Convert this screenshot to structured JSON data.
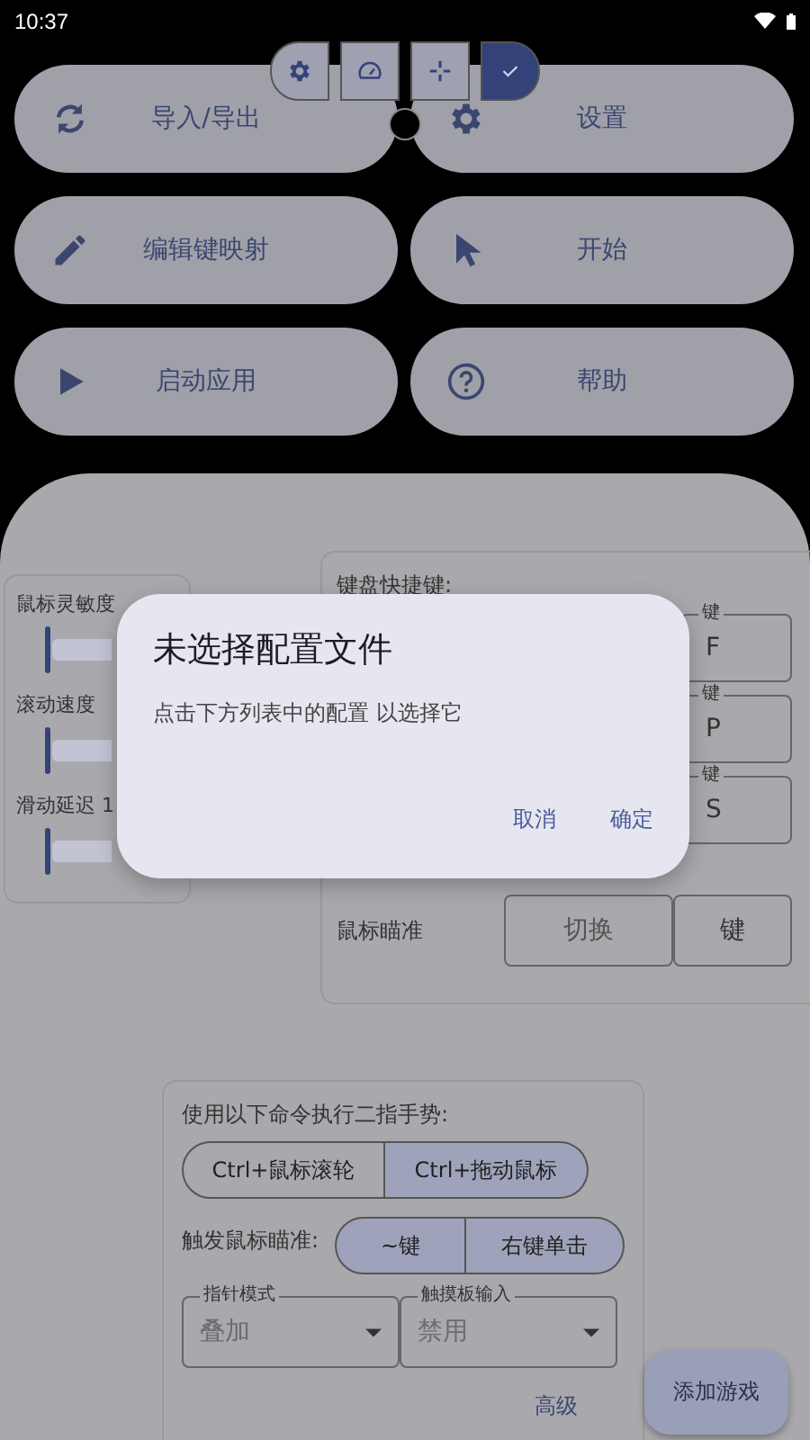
{
  "status_bar": {
    "time": "10:37"
  },
  "toolbar": [
    {
      "kind": "gear",
      "selected": false
    },
    {
      "kind": "gauge",
      "selected": false
    },
    {
      "kind": "crosshair",
      "selected": false
    },
    {
      "kind": "check",
      "selected": true
    }
  ],
  "actions": [
    {
      "kind": "sync",
      "label": "导入/导出"
    },
    {
      "kind": "gear",
      "label": "设置"
    },
    {
      "kind": "pencil",
      "label": "编辑键映射"
    },
    {
      "kind": "cursor",
      "label": "开始"
    },
    {
      "kind": "play",
      "label": "启动应用"
    },
    {
      "kind": "help",
      "label": "帮助"
    }
  ],
  "sliders": [
    {
      "label": "鼠标灵敏度",
      "level": 0
    },
    {
      "label": "滚动速度",
      "level": 0
    },
    {
      "label": "滑动延迟 1",
      "level": 0
    }
  ],
  "shortcuts": {
    "title": "键盘快捷键:",
    "keys": [
      {
        "label": "键",
        "value": "F"
      },
      {
        "label": "键",
        "value": "P"
      },
      {
        "label": "键",
        "value": "S"
      }
    ],
    "aim_label": "鼠标瞄准",
    "aim_mode": "切换",
    "aim_key": "键"
  },
  "gesture": {
    "title": "使用以下命令执行二指手势:",
    "options": [
      {
        "label": "Ctrl+鼠标滚轮",
        "selected": false
      },
      {
        "label": "Ctrl+拖动鼠标",
        "selected": true
      }
    ],
    "aim_label": "触发鼠标瞄准:",
    "aim_options": [
      {
        "label": "~键",
        "selected": true
      },
      {
        "label": "右键单击",
        "selected": true
      }
    ],
    "dropdowns": [
      {
        "label": "指针模式",
        "value": "叠加"
      },
      {
        "label": "触摸板输入",
        "value": "禁用"
      }
    ],
    "advanced": "高级"
  },
  "fab": "添加游戏",
  "dialog": {
    "title": "未选择配置文件",
    "message": "点击下方列表中的配置 以选择它",
    "buttons": [
      "取消",
      "确定"
    ]
  }
}
